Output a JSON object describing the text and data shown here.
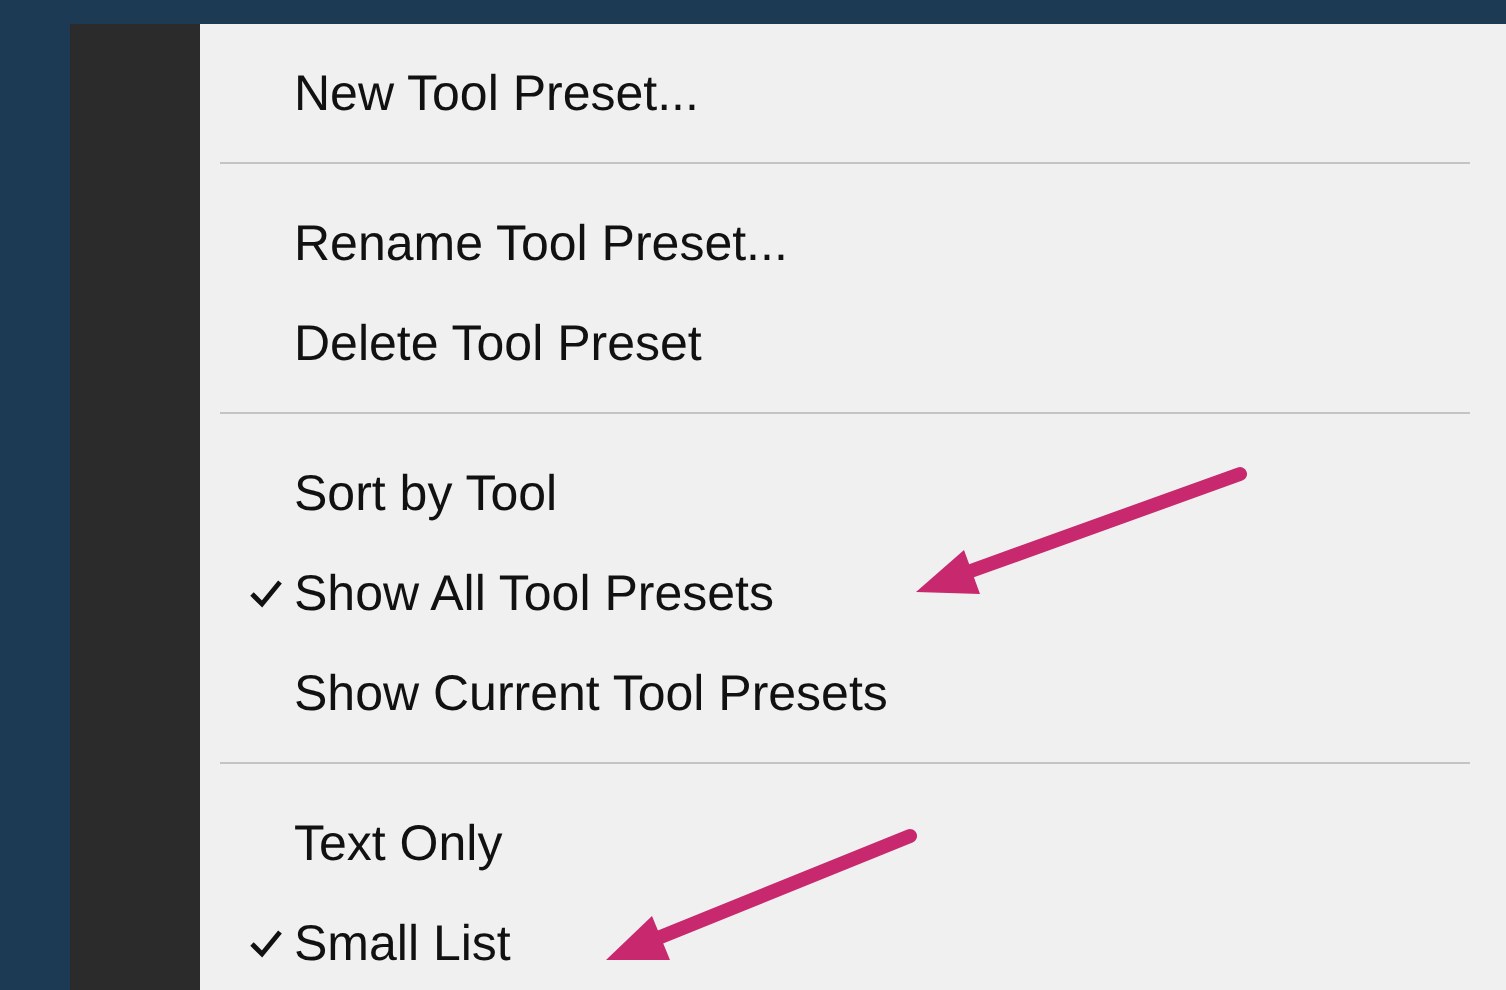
{
  "menu": {
    "groups": [
      [
        {
          "label": "New Tool Preset...",
          "checked": false
        }
      ],
      [
        {
          "label": "Rename Tool Preset...",
          "checked": false
        },
        {
          "label": "Delete Tool Preset",
          "checked": false
        }
      ],
      [
        {
          "label": "Sort by Tool",
          "checked": false
        },
        {
          "label": "Show All Tool Presets",
          "checked": true
        },
        {
          "label": "Show Current Tool Presets",
          "checked": false
        }
      ],
      [
        {
          "label": "Text Only",
          "checked": false
        },
        {
          "label": "Small List",
          "checked": true
        }
      ]
    ]
  }
}
